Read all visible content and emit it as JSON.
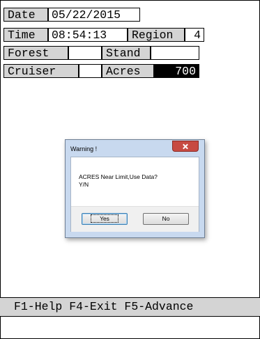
{
  "header": {
    "date_label": "Date",
    "date_value": "05/22/2015",
    "time_label": "Time",
    "time_value": "08:54:13",
    "region_label": "Region",
    "region_value": "4",
    "forest_label": "Forest",
    "forest_value": "",
    "stand_label": "Stand",
    "stand_value": "",
    "cruiser_label": "Cruiser",
    "cruiser_value": "",
    "acres_label": "Acres",
    "acres_value": "700"
  },
  "dialog": {
    "title": "Warning !",
    "message": "ACRES Near Limit,Use Data? Y/N",
    "yes_label": "Yes",
    "no_label": "No"
  },
  "statusbar": {
    "text": "F1-Help F4-Exit F5-Advance"
  }
}
